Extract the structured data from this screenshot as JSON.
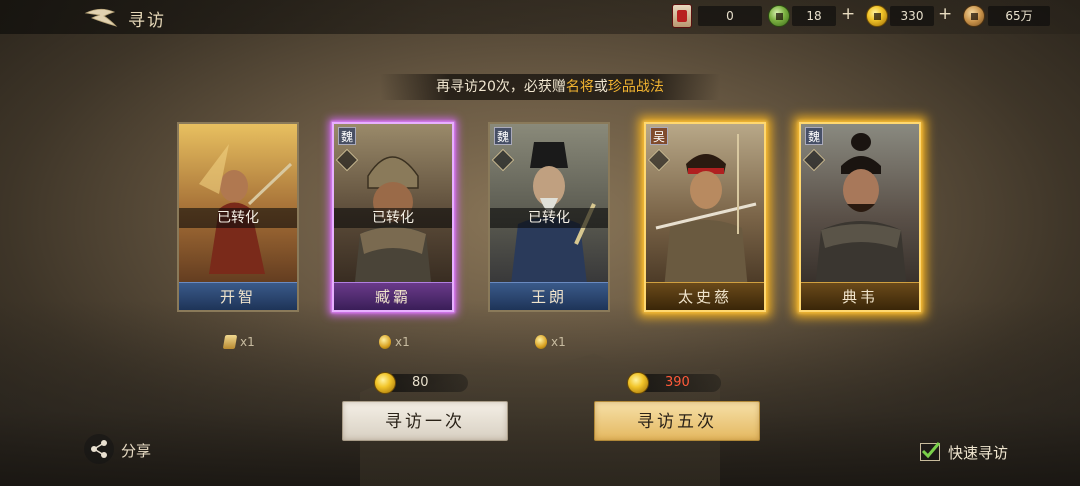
{
  "header": {
    "title": "寻访"
  },
  "resources": [
    {
      "name": "recruit-token",
      "value": "0"
    },
    {
      "name": "jade",
      "value": "18"
    },
    {
      "name": "gold",
      "value": "330"
    },
    {
      "name": "copper",
      "value": "65万"
    }
  ],
  "banner": {
    "prefix": "再寻访20次，必获赠",
    "hl1": "名将",
    "mid": "或",
    "hl2": "珍品战法"
  },
  "cards": [
    {
      "name": "开智",
      "status": "已转化",
      "faction": "",
      "rarity": "blue",
      "reward": "x1",
      "reward_icon": "scroll"
    },
    {
      "name": "臧霸",
      "status": "已转化",
      "faction": "魏",
      "rarity": "purple",
      "reward": "x1",
      "reward_icon": "gold"
    },
    {
      "name": "王朗",
      "status": "已转化",
      "faction": "魏",
      "rarity": "blue",
      "reward": "x1",
      "reward_icon": "gold"
    },
    {
      "name": "太史慈",
      "status": "",
      "faction": "吴",
      "rarity": "gold"
    },
    {
      "name": "典韦",
      "status": "",
      "faction": "魏",
      "rarity": "gold"
    }
  ],
  "actions": {
    "once": {
      "label": "寻访一次",
      "cost": "80"
    },
    "five": {
      "label": "寻访五次",
      "cost": "390"
    }
  },
  "share": {
    "label": "分享"
  },
  "quick": {
    "label": "快速寻访",
    "checked": true
  },
  "colors": {
    "highlight": "#f2b431",
    "cost_red": "#ff5a3a",
    "check_green": "#7ad04a"
  }
}
